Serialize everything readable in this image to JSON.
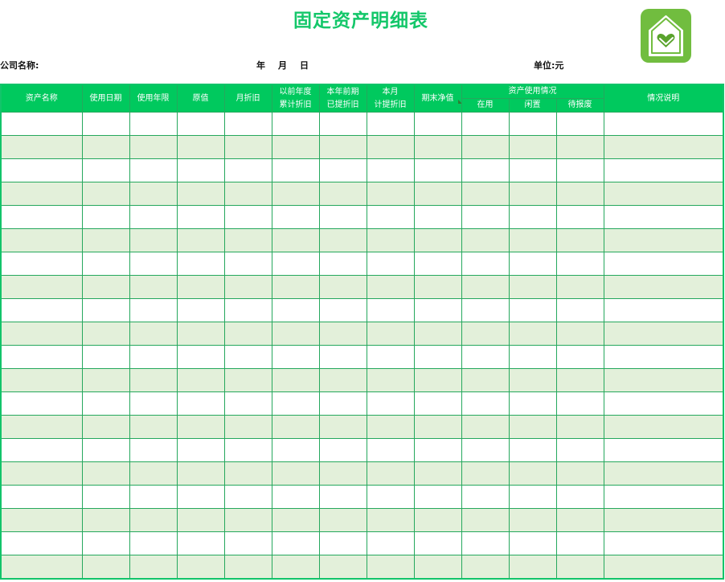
{
  "title": "固定资产明细表",
  "meta": {
    "company_label": "公司名称:",
    "year": "年",
    "month": "月",
    "day": "日",
    "unit_label": "单位:元"
  },
  "logo": {
    "icon": "house-heart-icon",
    "bg_color": "#71bd3f"
  },
  "table": {
    "headers": {
      "asset_name": "资产名称",
      "use_date": "使用日期",
      "use_years": "使用年限",
      "original_value": "原值",
      "monthly_depr": "月折旧",
      "prior_accum_line1": "以前年度",
      "prior_accum_line2": "累计折旧",
      "ytd_line1": "本年前期",
      "ytd_line2": "已提折旧",
      "this_month_line1": "本月",
      "this_month_line2": "计提折旧",
      "net_value": "期末净值",
      "usage_group": "资产使用情况",
      "in_use": "在用",
      "idle": "闲置",
      "pending_scrap": "待报废",
      "remarks": "情况说明"
    },
    "row_count": 20
  },
  "colors": {
    "header_bg": "#00c95e",
    "title": "#14c76a",
    "stripe": "#e3f0da",
    "grid_line": "#25a85d"
  }
}
